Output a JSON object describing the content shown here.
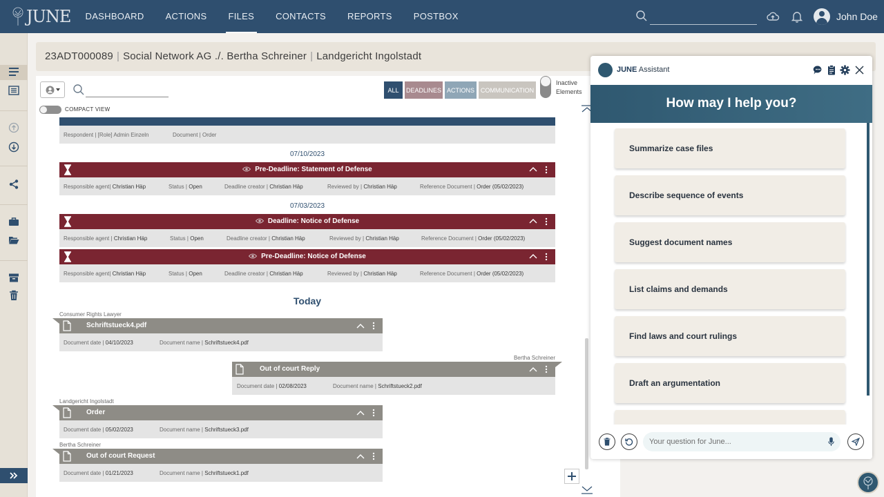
{
  "app": {
    "logo_text": "JUNE"
  },
  "nav": {
    "items": [
      "DASHBOARD",
      "ACTIONS",
      "FILES",
      "CONTACTS",
      "REPORTS",
      "POSTBOX"
    ],
    "active": "FILES"
  },
  "user": {
    "name": "John Doe"
  },
  "case": {
    "number": "23ADT000089",
    "parties": "Social Network AG ./. Bertha Schreiner",
    "court": "Landgericht Ingolstadt"
  },
  "filters": {
    "all": "ALL",
    "deadlines": "DEADLINES",
    "actions": "ACTIONS",
    "communication": "COMMUNICATION"
  },
  "inactive": {
    "line1": "Inactive",
    "line2": "Elements"
  },
  "compact_view": "COMPACT VIEW",
  "timeline": {
    "top_meta": {
      "respondent": "Respondent | [Role] Admin Einzeln",
      "document": "Document | Order"
    },
    "date1": "07/10/2023",
    "date2": "07/03/2023",
    "deadlines": [
      {
        "title": "Pre-Deadline: Statement of Defense",
        "agent_label": "Responsible agent|",
        "agent": "Christian Häp",
        "status_label": "Status |",
        "status": "Open",
        "creator_label": "Deadline creator |",
        "creator": "Christian Häp",
        "reviewed_label": "Reviewed by |",
        "reviewed": "Christian Häp",
        "ref_label": "Reference Document |",
        "ref": "Order (05/02/2023)"
      },
      {
        "title": "Deadline: Notice of Defense",
        "agent_label": "Responsible agent |",
        "agent": "Christian Häp",
        "status_label": "Status |",
        "status": "Open",
        "creator_label": "Deadline creator |",
        "creator": "Christian Häp",
        "reviewed_label": "Reviewed by |",
        "reviewed": "Christian Häp",
        "ref_label": "Reference Document |",
        "ref": "Order (05/02/2023)"
      },
      {
        "title": "Pre-Deadline: Notice of Defense",
        "agent_label": "Responsible agent|",
        "agent": "Christian Häp",
        "status_label": "Status |",
        "status": "Open",
        "creator_label": "Deadline creator |",
        "creator": "Christian Häp",
        "reviewed_label": "Reviewed by |",
        "reviewed": "Christian Häp",
        "ref_label": "Reference Document |",
        "ref": "Order (05/02/2023)"
      }
    ],
    "today": "Today",
    "docs": [
      {
        "author": "Consumer Rights Lawyer",
        "title": "Schriftstueck4.pdf",
        "date_label": "Document date |",
        "date": "04/10/2023",
        "name_label": "Document name |",
        "name": "Schriftstueck4.pdf"
      },
      {
        "author": "Bertha Schreiner",
        "title": "Out of court Reply",
        "date_label": "Document date |",
        "date": "02/08/2023",
        "name_label": "Document name |",
        "name": "Schriftstueck2.pdf"
      },
      {
        "author": "Landgericht Ingolstadt",
        "title": "Order",
        "date_label": "Document date |",
        "date": "05/02/2023",
        "name_label": "Document name |",
        "name": "Schriftstueck3.pdf"
      },
      {
        "author": "Bertha Schreiner",
        "title": "Out of court Request",
        "date_label": "Document date |",
        "date": "01/21/2023",
        "name_label": "Document name |",
        "name": "Schriftstueck1.pdf"
      }
    ]
  },
  "assistant": {
    "brand": "JUNE",
    "title": "Assistant",
    "heading": "How may I help you?",
    "options": [
      "Summarize case files",
      "Describe sequence of events",
      "Suggest document names",
      "List claims and demands",
      "Find laws and court rulings",
      "Draft an argumentation"
    ],
    "input_placeholder": "Your question for June..."
  },
  "colors": {
    "primary": "#2f4f6f",
    "deadline": "#7a2531",
    "document": "#8e8c86",
    "filter_deadlines": "#a88a8f",
    "filter_actions": "#8fa6b6",
    "filter_communication": "#c9c5bf",
    "beige": "#e9e4db"
  }
}
